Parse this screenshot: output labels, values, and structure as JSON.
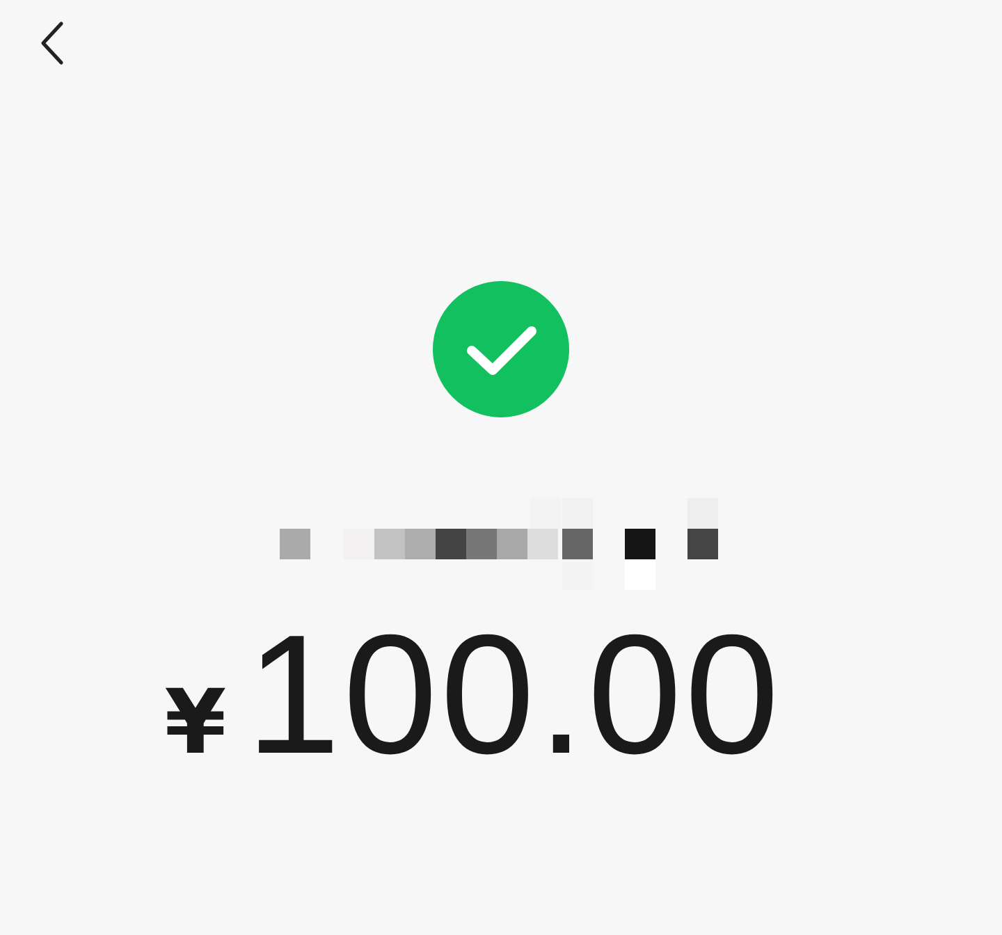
{
  "status": {
    "kind": "success"
  },
  "amount": {
    "currency": "¥",
    "value": "100.00"
  }
}
